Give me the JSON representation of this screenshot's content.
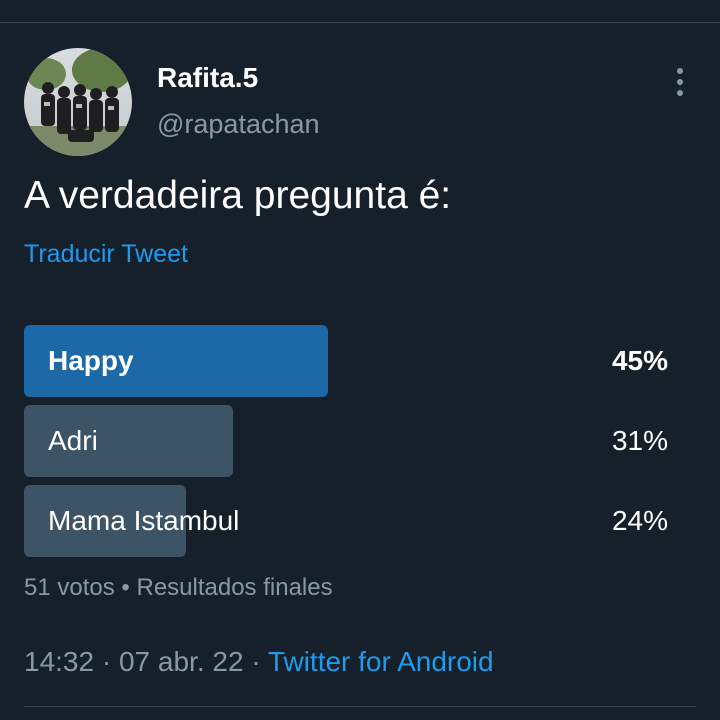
{
  "author": {
    "display_name": "Rafita.5",
    "handle": "@rapatachan"
  },
  "tweet": {
    "text": "A verdadeira pregunta é:",
    "translate_label": "Traducir Tweet"
  },
  "poll": {
    "options": [
      {
        "label": "Happy",
        "percent_label": "45%",
        "percent": 45,
        "winner": true
      },
      {
        "label": "Adri",
        "percent_label": "31%",
        "percent": 31,
        "winner": false
      },
      {
        "label": "Mama Istambul",
        "percent_label": "24%",
        "percent": 24,
        "winner": false
      }
    ],
    "votes": "51 votos",
    "meta_separator": "•",
    "status": "Resultados finales"
  },
  "footer": {
    "time": "14:32",
    "date": "07 abr. 22",
    "separator": "·",
    "source": "Twitter for Android"
  },
  "colors": {
    "background": "#15202b",
    "accent": "#1d9bf0",
    "winner_bar": "#1d68a6",
    "bar": "#3d5466",
    "muted_text": "#8899a6"
  },
  "icons": {
    "more": "more-vertical-icon"
  }
}
